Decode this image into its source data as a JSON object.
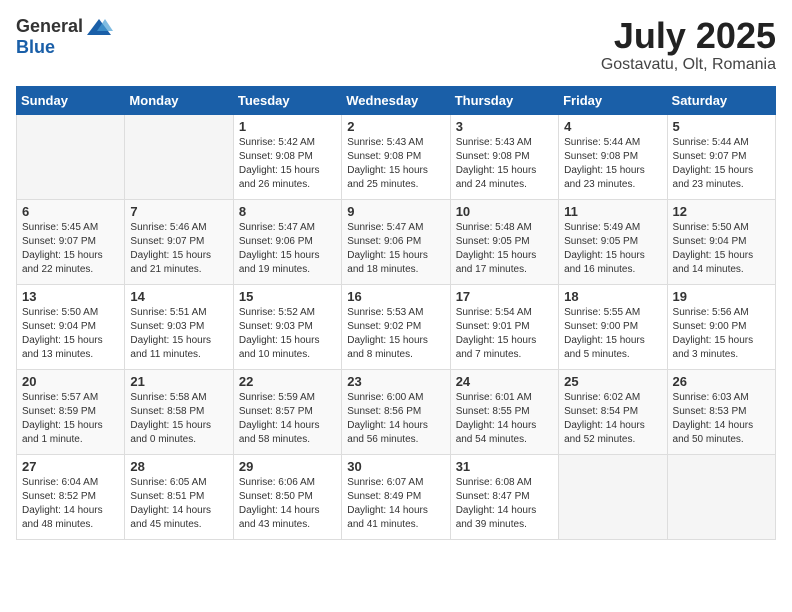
{
  "header": {
    "logo_general": "General",
    "logo_blue": "Blue",
    "month_title": "July 2025",
    "location": "Gostavatu, Olt, Romania"
  },
  "days_of_week": [
    "Sunday",
    "Monday",
    "Tuesday",
    "Wednesday",
    "Thursday",
    "Friday",
    "Saturday"
  ],
  "weeks": [
    [
      {
        "day": "",
        "info": ""
      },
      {
        "day": "",
        "info": ""
      },
      {
        "day": "1",
        "info": "Sunrise: 5:42 AM\nSunset: 9:08 PM\nDaylight: 15 hours\nand 26 minutes."
      },
      {
        "day": "2",
        "info": "Sunrise: 5:43 AM\nSunset: 9:08 PM\nDaylight: 15 hours\nand 25 minutes."
      },
      {
        "day": "3",
        "info": "Sunrise: 5:43 AM\nSunset: 9:08 PM\nDaylight: 15 hours\nand 24 minutes."
      },
      {
        "day": "4",
        "info": "Sunrise: 5:44 AM\nSunset: 9:08 PM\nDaylight: 15 hours\nand 23 minutes."
      },
      {
        "day": "5",
        "info": "Sunrise: 5:44 AM\nSunset: 9:07 PM\nDaylight: 15 hours\nand 23 minutes."
      }
    ],
    [
      {
        "day": "6",
        "info": "Sunrise: 5:45 AM\nSunset: 9:07 PM\nDaylight: 15 hours\nand 22 minutes."
      },
      {
        "day": "7",
        "info": "Sunrise: 5:46 AM\nSunset: 9:07 PM\nDaylight: 15 hours\nand 21 minutes."
      },
      {
        "day": "8",
        "info": "Sunrise: 5:47 AM\nSunset: 9:06 PM\nDaylight: 15 hours\nand 19 minutes."
      },
      {
        "day": "9",
        "info": "Sunrise: 5:47 AM\nSunset: 9:06 PM\nDaylight: 15 hours\nand 18 minutes."
      },
      {
        "day": "10",
        "info": "Sunrise: 5:48 AM\nSunset: 9:05 PM\nDaylight: 15 hours\nand 17 minutes."
      },
      {
        "day": "11",
        "info": "Sunrise: 5:49 AM\nSunset: 9:05 PM\nDaylight: 15 hours\nand 16 minutes."
      },
      {
        "day": "12",
        "info": "Sunrise: 5:50 AM\nSunset: 9:04 PM\nDaylight: 15 hours\nand 14 minutes."
      }
    ],
    [
      {
        "day": "13",
        "info": "Sunrise: 5:50 AM\nSunset: 9:04 PM\nDaylight: 15 hours\nand 13 minutes."
      },
      {
        "day": "14",
        "info": "Sunrise: 5:51 AM\nSunset: 9:03 PM\nDaylight: 15 hours\nand 11 minutes."
      },
      {
        "day": "15",
        "info": "Sunrise: 5:52 AM\nSunset: 9:03 PM\nDaylight: 15 hours\nand 10 minutes."
      },
      {
        "day": "16",
        "info": "Sunrise: 5:53 AM\nSunset: 9:02 PM\nDaylight: 15 hours\nand 8 minutes."
      },
      {
        "day": "17",
        "info": "Sunrise: 5:54 AM\nSunset: 9:01 PM\nDaylight: 15 hours\nand 7 minutes."
      },
      {
        "day": "18",
        "info": "Sunrise: 5:55 AM\nSunset: 9:00 PM\nDaylight: 15 hours\nand 5 minutes."
      },
      {
        "day": "19",
        "info": "Sunrise: 5:56 AM\nSunset: 9:00 PM\nDaylight: 15 hours\nand 3 minutes."
      }
    ],
    [
      {
        "day": "20",
        "info": "Sunrise: 5:57 AM\nSunset: 8:59 PM\nDaylight: 15 hours\nand 1 minute."
      },
      {
        "day": "21",
        "info": "Sunrise: 5:58 AM\nSunset: 8:58 PM\nDaylight: 15 hours\nand 0 minutes."
      },
      {
        "day": "22",
        "info": "Sunrise: 5:59 AM\nSunset: 8:57 PM\nDaylight: 14 hours\nand 58 minutes."
      },
      {
        "day": "23",
        "info": "Sunrise: 6:00 AM\nSunset: 8:56 PM\nDaylight: 14 hours\nand 56 minutes."
      },
      {
        "day": "24",
        "info": "Sunrise: 6:01 AM\nSunset: 8:55 PM\nDaylight: 14 hours\nand 54 minutes."
      },
      {
        "day": "25",
        "info": "Sunrise: 6:02 AM\nSunset: 8:54 PM\nDaylight: 14 hours\nand 52 minutes."
      },
      {
        "day": "26",
        "info": "Sunrise: 6:03 AM\nSunset: 8:53 PM\nDaylight: 14 hours\nand 50 minutes."
      }
    ],
    [
      {
        "day": "27",
        "info": "Sunrise: 6:04 AM\nSunset: 8:52 PM\nDaylight: 14 hours\nand 48 minutes."
      },
      {
        "day": "28",
        "info": "Sunrise: 6:05 AM\nSunset: 8:51 PM\nDaylight: 14 hours\nand 45 minutes."
      },
      {
        "day": "29",
        "info": "Sunrise: 6:06 AM\nSunset: 8:50 PM\nDaylight: 14 hours\nand 43 minutes."
      },
      {
        "day": "30",
        "info": "Sunrise: 6:07 AM\nSunset: 8:49 PM\nDaylight: 14 hours\nand 41 minutes."
      },
      {
        "day": "31",
        "info": "Sunrise: 6:08 AM\nSunset: 8:47 PM\nDaylight: 14 hours\nand 39 minutes."
      },
      {
        "day": "",
        "info": ""
      },
      {
        "day": "",
        "info": ""
      }
    ]
  ]
}
